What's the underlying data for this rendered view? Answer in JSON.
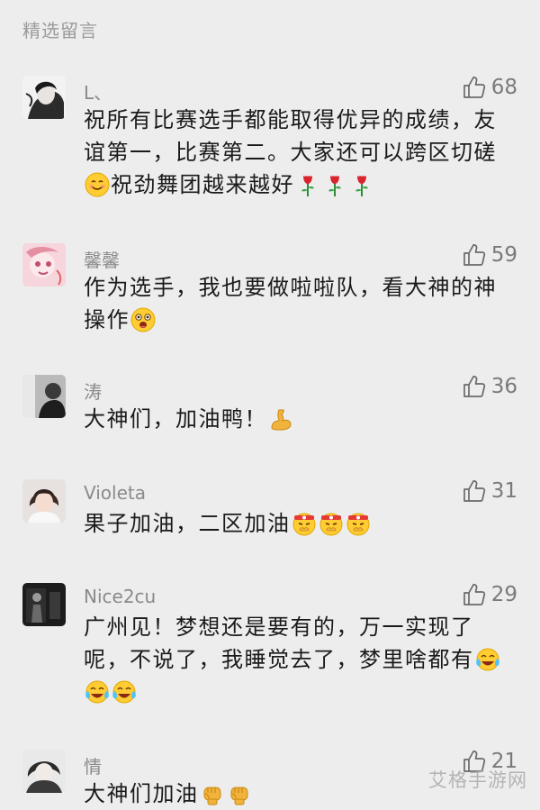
{
  "section_title": "精选留言",
  "watermark": "艾格手游网",
  "comments": [
    {
      "name": "L、",
      "likes": "68",
      "segments": [
        {
          "t": "text",
          "v": "祝所有比赛选手都能取得优异的成绩，友谊第一，比赛第二。大家还可以跨区切磋"
        },
        {
          "t": "emoji",
          "v": "smile-emoji"
        },
        {
          "t": "text",
          "v": "祝劲舞团越来越好"
        },
        {
          "t": "emoji",
          "v": "rose-emoji"
        },
        {
          "t": "emoji",
          "v": "rose-emoji"
        },
        {
          "t": "emoji",
          "v": "rose-emoji"
        }
      ]
    },
    {
      "name": "馨馨",
      "likes": "59",
      "segments": [
        {
          "t": "text",
          "v": "作为选手，我也要做啦啦队，看大神的神操作"
        },
        {
          "t": "emoji",
          "v": "wow-emoji"
        }
      ]
    },
    {
      "name": "涛",
      "likes": "36",
      "segments": [
        {
          "t": "text",
          "v": "大神们，加油鸭！"
        },
        {
          "t": "emoji",
          "v": "muscle-emoji"
        }
      ]
    },
    {
      "name": "Violeta",
      "likes": "31",
      "segments": [
        {
          "t": "text",
          "v": "果子加油，二区加油"
        },
        {
          "t": "emoji",
          "v": "fighting-emoji"
        },
        {
          "t": "emoji",
          "v": "fighting-emoji"
        },
        {
          "t": "emoji",
          "v": "fighting-emoji"
        }
      ]
    },
    {
      "name": "Nice2cu",
      "likes": "29",
      "segments": [
        {
          "t": "text",
          "v": "广州见！梦想还是要有的，万一实现了呢，不说了，我睡觉去了，梦里啥都有"
        },
        {
          "t": "emoji",
          "v": "tears-of-joy-emoji"
        },
        {
          "t": "emoji",
          "v": "tears-of-joy-emoji"
        },
        {
          "t": "emoji",
          "v": "tears-of-joy-emoji"
        }
      ]
    },
    {
      "name": "情",
      "likes": "21",
      "segments": [
        {
          "t": "text",
          "v": "大神们加油"
        },
        {
          "t": "emoji",
          "v": "fist-emoji"
        },
        {
          "t": "emoji",
          "v": "fist-emoji"
        }
      ]
    }
  ]
}
